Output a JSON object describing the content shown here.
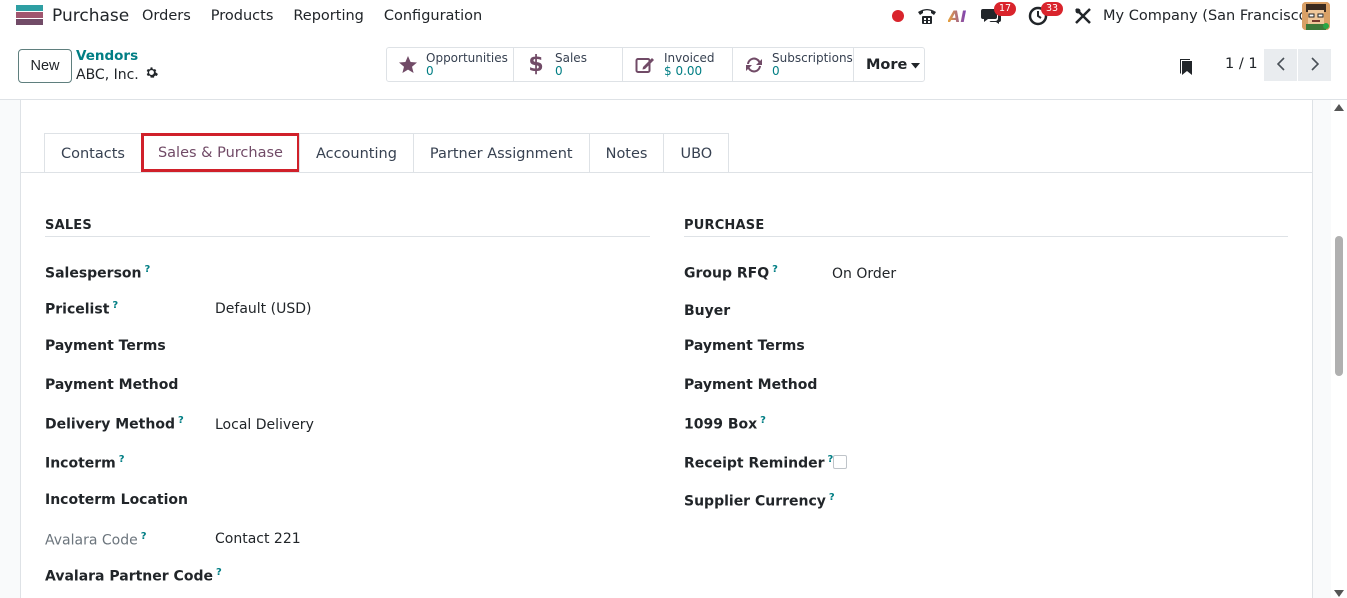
{
  "navbar": {
    "app_name": "Purchase",
    "menu": [
      "Orders",
      "Products",
      "Reporting",
      "Configuration"
    ],
    "chat_badge": "17",
    "activity_badge": "33",
    "ai_label": "AI",
    "company": "My Company (San Francisco)"
  },
  "control": {
    "new_label": "New",
    "breadcrumb_parent": "Vendors",
    "breadcrumb_current": "ABC, Inc.",
    "smart_buttons": [
      {
        "label": "Opportunities",
        "value": "0",
        "icon": "star-icon"
      },
      {
        "label": "Sales",
        "value": "0",
        "icon": "dollar-icon"
      },
      {
        "label": "Invoiced",
        "value": "$ 0.00",
        "icon": "edit-icon"
      },
      {
        "label": "Subscriptions",
        "value": "0",
        "icon": "refresh-icon"
      }
    ],
    "more_label": "More",
    "pager": "1 / 1"
  },
  "tabs": [
    {
      "label": "Contacts",
      "active": false
    },
    {
      "label": "Sales & Purchase",
      "active": true
    },
    {
      "label": "Accounting",
      "active": false
    },
    {
      "label": "Partner Assignment",
      "active": false
    },
    {
      "label": "Notes",
      "active": false
    },
    {
      "label": "UBO",
      "active": false
    }
  ],
  "sales": {
    "title": "SALES",
    "fields": [
      {
        "label": "Salesperson",
        "help": "?",
        "value": ""
      },
      {
        "label": "Pricelist",
        "help": "?",
        "value": "Default (USD)"
      },
      {
        "label": "Payment Terms",
        "help": "",
        "value": ""
      },
      {
        "label": "Payment Method",
        "help": "",
        "value": ""
      },
      {
        "label": "Delivery Method",
        "help": "?",
        "value": "Local Delivery"
      },
      {
        "label": "Incoterm",
        "help": "?",
        "value": ""
      },
      {
        "label": "Incoterm Location",
        "help": "",
        "value": ""
      },
      {
        "label": "Avalara Code",
        "help": "?",
        "value": "Contact 221"
      },
      {
        "label": "Avalara Partner Code",
        "help": "?",
        "value": ""
      }
    ]
  },
  "purchase": {
    "title": "PURCHASE",
    "fields": [
      {
        "label": "Group RFQ",
        "help": "?",
        "value": "On Order"
      },
      {
        "label": "Buyer",
        "help": "",
        "value": ""
      },
      {
        "label": "Payment Terms",
        "help": "",
        "value": ""
      },
      {
        "label": "Payment Method",
        "help": "",
        "value": ""
      },
      {
        "label": "1099 Box",
        "help": "?",
        "value": ""
      },
      {
        "label": "Receipt Reminder",
        "help": "?",
        "value": ""
      },
      {
        "label": "Supplier Currency",
        "help": "?",
        "value": ""
      }
    ]
  },
  "colors": {
    "brand": "#714b67",
    "accent": "#017e84",
    "badge": "#d9242c",
    "active_tab_outline": "#d0202a"
  }
}
